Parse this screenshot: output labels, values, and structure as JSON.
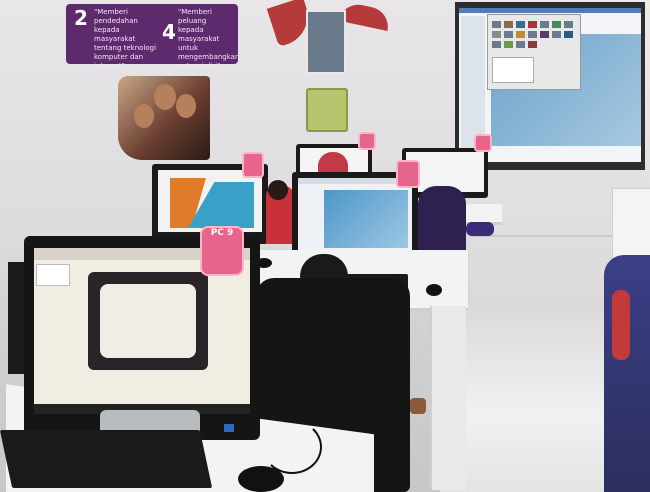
{
  "banner": {
    "number_left": "2",
    "text_left": "\"Memberi pendedahan kepada masyarakat tentang teknologi komputer dan internet\"",
    "number_right": "4",
    "text_right": "\"Memberi peluang kepada masyarakat untuk mengembangkan potensi diri\""
  },
  "badges": {
    "front": "PC 9",
    "middle": "",
    "back_left": "",
    "back_right": "",
    "far": ""
  },
  "colors": {
    "banner_purple": "#5d2a6e",
    "badge_pink": "#e7648a",
    "accent_red": "#b53a3a",
    "floor": "#e6e6e6"
  }
}
